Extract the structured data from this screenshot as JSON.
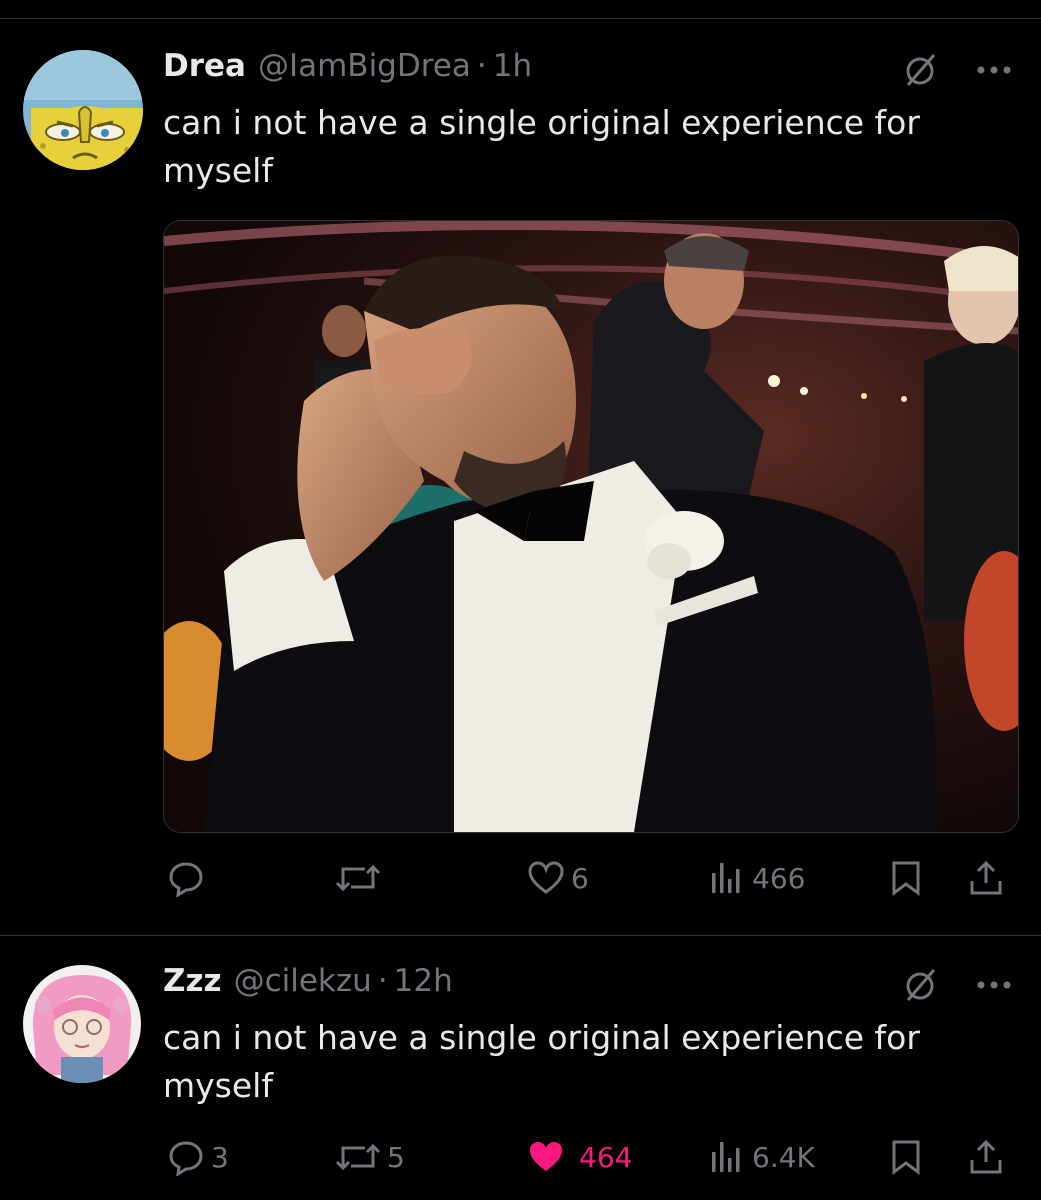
{
  "tweets": [
    {
      "name": "Drea",
      "handle": "@IamBigDrea",
      "separator": "·",
      "time": "1h",
      "text": "can i not have a single original experience for myself",
      "has_media": true,
      "actions": {
        "reply_count": "",
        "retweet_count": "",
        "like_count": "6",
        "view_count": "466",
        "liked": false
      }
    },
    {
      "name": "Zzz",
      "handle": "@cilekzu",
      "separator": "·",
      "time": "12h",
      "text": "can i not have a single original experience for myself",
      "has_media": false,
      "actions": {
        "reply_count": "3",
        "retweet_count": "5",
        "like_count": "464",
        "view_count": "6.4K",
        "liked": true
      }
    }
  ],
  "colors": {
    "background": "#000000",
    "text": "#e7e9ea",
    "muted": "#71767b",
    "like_active": "#f91880",
    "divider": "#2f3336"
  },
  "icons": [
    "grok-icon",
    "more-icon",
    "reply-icon",
    "retweet-icon",
    "heart-icon",
    "views-icon",
    "bookmark-icon",
    "share-icon"
  ]
}
